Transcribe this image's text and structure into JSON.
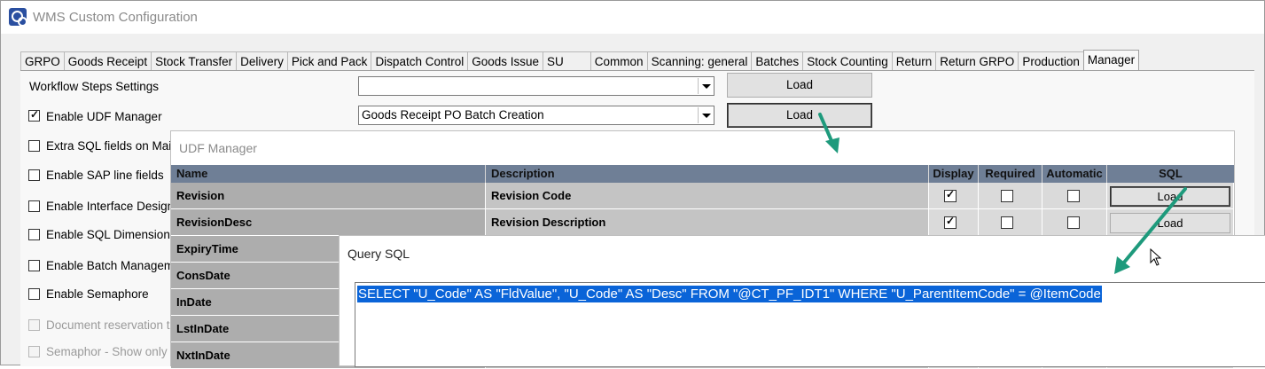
{
  "window": {
    "title": "WMS Custom Configuration"
  },
  "tabs": [
    "GRPO",
    "Goods Receipt",
    "Stock Transfer",
    "Delivery",
    "Pick and Pack",
    "Dispatch Control",
    "Goods Issue",
    "SU",
    "Common",
    "Scanning: general",
    "Batches",
    "Stock Counting",
    "Return",
    "Return GRPO",
    "Production",
    "Manager"
  ],
  "active_tab": "Manager",
  "settings": {
    "workflow_label": "Workflow Steps Settings",
    "workflow_combo_value": "",
    "workflow_load": "Load",
    "udf_label": "Enable UDF Manager",
    "udf_combo_value": "Goods Receipt PO Batch Creation",
    "udf_load": "Load",
    "options": [
      {
        "label": "Extra SQL fields on Main",
        "checked": false,
        "disabled": false
      },
      {
        "label": "Enable SAP line fields",
        "checked": false,
        "disabled": false
      },
      {
        "label": "Enable Interface Design",
        "checked": false,
        "disabled": false
      },
      {
        "label": "Enable SQL Dimensions",
        "checked": false,
        "disabled": false
      },
      {
        "label": "Enable Batch Manageme",
        "checked": false,
        "disabled": false
      },
      {
        "label": "Enable Semaphore",
        "checked": false,
        "disabled": false
      },
      {
        "label": "Document reservation tim",
        "checked": false,
        "disabled": true
      },
      {
        "label": "Semaphor - Show only fi",
        "checked": false,
        "disabled": true
      }
    ]
  },
  "udf_manager": {
    "title": "UDF Manager",
    "columns": {
      "name": "Name",
      "description": "Description",
      "display": "Display",
      "required": "Required",
      "automatic": "Automatic",
      "sql": "SQL"
    },
    "rows": [
      {
        "name": "Revision",
        "description": "Revision Code",
        "display": true,
        "required": false,
        "automatic": false,
        "sql": "Load"
      },
      {
        "name": "RevisionDesc",
        "description": "Revision Description",
        "display": true,
        "required": false,
        "automatic": false,
        "sql": "Load"
      },
      {
        "name": "ExpiryTime"
      },
      {
        "name": "ConsDate"
      },
      {
        "name": "InDate"
      },
      {
        "name": "LstInDate"
      },
      {
        "name": "NxtInDate"
      }
    ]
  },
  "query_sql": {
    "title": "Query SQL",
    "text": "SELECT \"U_Code\" AS \"FldValue\", \"U_Code\" AS \"Desc\" FROM \"@CT_PF_IDT1\" WHERE \"U_ParentItemCode\" = @ItemCode"
  },
  "colors": {
    "annotation_arrow": "#1e9a7c",
    "grid_header": "#6f7f96",
    "selection": "#0a64d8"
  }
}
